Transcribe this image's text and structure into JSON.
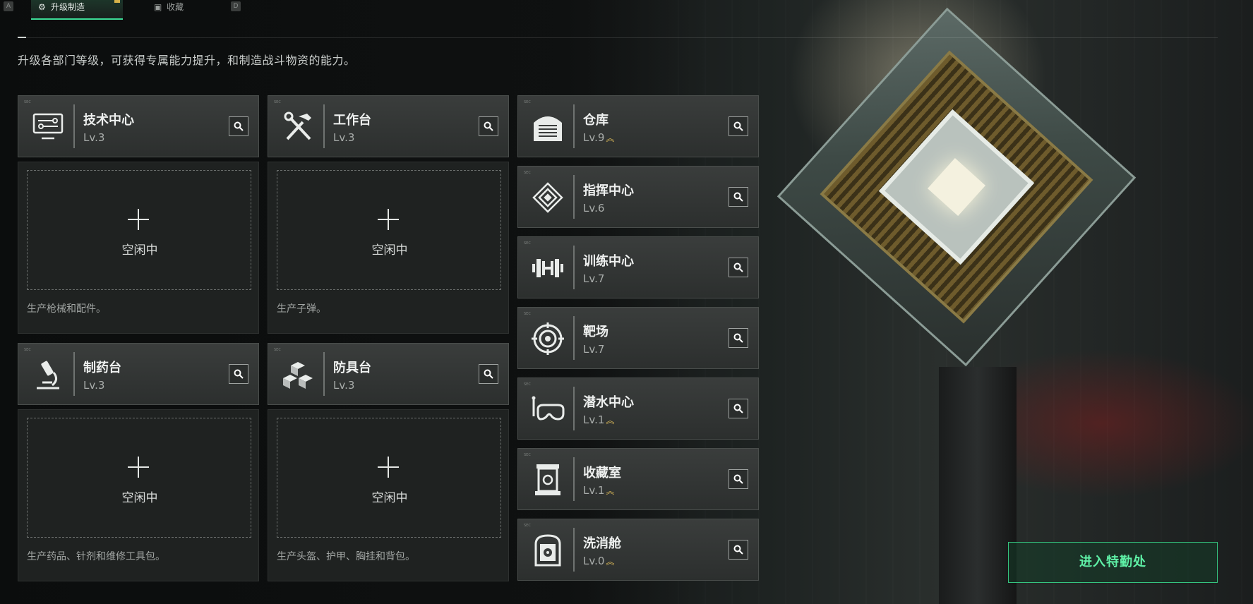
{
  "tabs": [
    {
      "label": "升级制造",
      "active": true
    },
    {
      "label": "收藏",
      "active": false
    }
  ],
  "key_hints": {
    "left": "A",
    "right": "D"
  },
  "subtitle": "升级各部门等级，可获得专属能力提升，和制造战斗物资的能力。",
  "workshops": [
    {
      "name": "技术中心",
      "level": "Lv.3",
      "icon": "computer-icon",
      "status": "空闲中",
      "desc": "生产枪械和配件。"
    },
    {
      "name": "工作台",
      "level": "Lv.3",
      "icon": "tools-icon",
      "status": "空闲中",
      "desc": "生产子弹。"
    },
    {
      "name": "制药台",
      "level": "Lv.3",
      "icon": "microscope-icon",
      "status": "空闲中",
      "desc": "生产药品、针剂和维修工具包。"
    },
    {
      "name": "防具台",
      "level": "Lv.3",
      "icon": "cubes-icon",
      "status": "空闲中",
      "desc": "生产头盔、护甲、胸挂和背包。"
    }
  ],
  "facilities": [
    {
      "name": "仓库",
      "level": "Lv.9",
      "icon": "warehouse-icon",
      "upgradable": true
    },
    {
      "name": "指挥中心",
      "level": "Lv.6",
      "icon": "command-chip-icon",
      "upgradable": false
    },
    {
      "name": "训练中心",
      "level": "Lv.7",
      "icon": "dumbbell-icon",
      "upgradable": false
    },
    {
      "name": "靶场",
      "level": "Lv.7",
      "icon": "target-icon",
      "upgradable": false
    },
    {
      "name": "潜水中心",
      "level": "Lv.1",
      "icon": "diving-mask-icon",
      "upgradable": true
    },
    {
      "name": "收藏室",
      "level": "Lv.1",
      "icon": "display-case-icon",
      "upgradable": true
    },
    {
      "name": "洗消舱",
      "level": "Lv.0",
      "icon": "decon-chamber-icon",
      "upgradable": true
    }
  ],
  "enter_button": "进入特勤处",
  "colors": {
    "accent": "#3ddc97",
    "upgrade_arrow": "#d2b256"
  }
}
